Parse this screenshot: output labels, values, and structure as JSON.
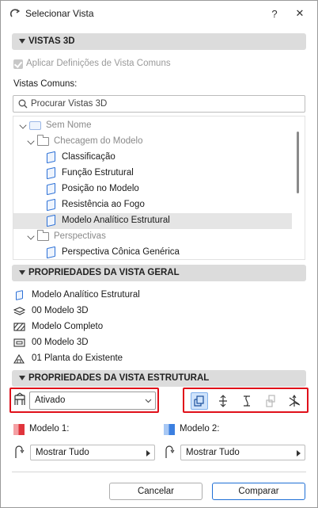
{
  "window": {
    "title": "Selecionar Vista",
    "help_label": "?",
    "close_label": "✕"
  },
  "section_3d": {
    "label": "VISTAS 3D"
  },
  "apply_common": {
    "label": "Aplicar Definições de Vista Comuns",
    "checked": true,
    "enabled": false
  },
  "common_views_label": "Vistas Comuns:",
  "search": {
    "placeholder": "Procurar Vistas 3D",
    "value": ""
  },
  "tree": {
    "items": [
      {
        "label": "Sem Nome",
        "level": 0,
        "icon": "3d-window-icon",
        "expanded": true,
        "grey": true
      },
      {
        "label": "Checagem do Modelo",
        "level": 1,
        "icon": "folder-icon",
        "expanded": true,
        "grey": true
      },
      {
        "label": "Classificação",
        "level": 2,
        "icon": "view-icon"
      },
      {
        "label": "Função Estrutural",
        "level": 2,
        "icon": "view-icon"
      },
      {
        "label": "Posição no Modelo",
        "level": 2,
        "icon": "view-icon"
      },
      {
        "label": "Resistência ao Fogo",
        "level": 2,
        "icon": "view-icon"
      },
      {
        "label": "Modelo Analítico Estrutural",
        "level": 2,
        "icon": "view-icon",
        "selected": true
      },
      {
        "label": "Perspectivas",
        "level": 1,
        "icon": "folder-icon",
        "expanded": true,
        "grey": true
      },
      {
        "label": "Perspectiva Cônica Genérica",
        "level": 2,
        "icon": "view-icon"
      }
    ]
  },
  "section_general": {
    "label": "PROPRIEDADES DA VISTA GERAL"
  },
  "general_props": [
    {
      "icon": "view-icon",
      "label": "Modelo Analítico Estrutural"
    },
    {
      "icon": "layers-icon",
      "label": "00 Modelo 3D"
    },
    {
      "icon": "model-display-icon",
      "label": "Modelo Completo"
    },
    {
      "icon": "pen-set-icon",
      "label": "00 Modelo 3D"
    },
    {
      "icon": "renovation-filter-icon",
      "label": "01 Planta do Existente"
    }
  ],
  "section_structural": {
    "label": "PROPRIEDADES DA VISTA ESTRUTURAL"
  },
  "structural": {
    "mode_value": "Ativado",
    "toolbar_icons": [
      "surface-view-icon",
      "analytical-members-icon",
      "supports-icon",
      "links-icon",
      "axes-icon"
    ]
  },
  "model1": {
    "label": "Modelo 1:",
    "color": "#e0343c",
    "filter_value": "Mostrar Tudo"
  },
  "model2": {
    "label": "Modelo 2:",
    "color": "#3b7fe0",
    "filter_value": "Mostrar Tudo"
  },
  "footer": {
    "cancel_label": "Cancelar",
    "compare_label": "Comparar"
  }
}
